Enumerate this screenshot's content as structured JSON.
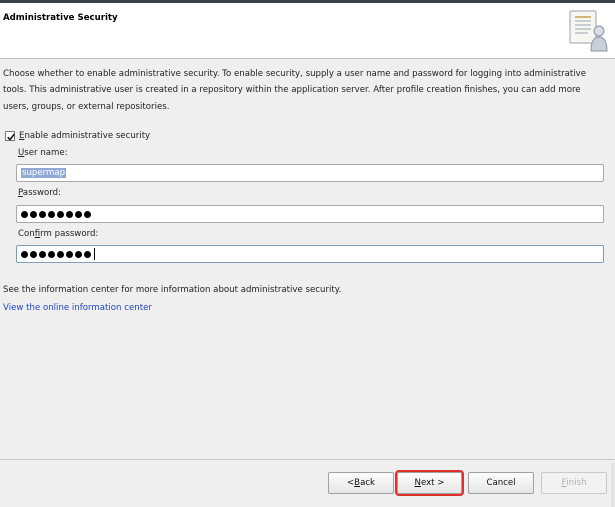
{
  "header": {
    "title": "Administrative Security"
  },
  "description": "Choose whether to enable administrative security. To enable security, supply a user name and password for logging into administrative tools. This administrative user is created in a repository within the application server. After profile creation finishes, you can add more users, groups, or external repositories.",
  "security_checkbox": {
    "checked": true,
    "mnemonic": "E",
    "label_rest": "nable administrative security"
  },
  "user_name": {
    "mnemonic": "U",
    "label_rest": "ser name:",
    "value": "supermap"
  },
  "password": {
    "mnemonic": "P",
    "label_rest": "assword:",
    "masked_length": 8
  },
  "confirm_password": {
    "label_pre": "Con",
    "mnemonic": "f",
    "label_rest": "irm password:",
    "masked_length": 8
  },
  "info_text": "See the information center for more information about administrative security.",
  "info_link": "View the online information center",
  "buttons": {
    "back_prefix": "< ",
    "back_mnemonic": "B",
    "back_rest": "ack",
    "next_mnemonic": "N",
    "next_rest": "ext >",
    "cancel": "Cancel",
    "finish_mnemonic": "F",
    "finish_rest": "inish"
  },
  "colors": {
    "link": "#1f45c4",
    "highlight_outline": "#e0302a",
    "selection": "#8fa9d6"
  }
}
